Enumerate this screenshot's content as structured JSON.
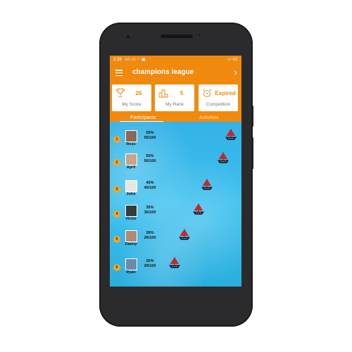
{
  "status": {
    "time": "3:38",
    "signal": "ııl ııl ◔ ▣",
    "right": "▭ 42"
  },
  "appbar": {
    "title": "champions league"
  },
  "cards": [
    {
      "value": "26",
      "label": "My Score",
      "icon": "trophy-icon"
    },
    {
      "value": "5",
      "label": "My Rank",
      "icon": "podium-icon"
    },
    {
      "value": "Expired",
      "label": "Competition",
      "icon": "alarm-clock-icon"
    }
  ],
  "tabs": {
    "participants": "Participants",
    "activities": "Activities"
  },
  "participants": [
    {
      "rank": "1",
      "name": "Ross",
      "percent": "55%",
      "score": "55/100",
      "progress": 0.55
    },
    {
      "rank": "2",
      "name": "April",
      "percent": "50%",
      "score": "50/100",
      "progress": 0.5
    },
    {
      "rank": "3",
      "name": "John",
      "percent": "40%",
      "score": "40/100",
      "progress": 0.4
    },
    {
      "rank": "4",
      "name": "Victor",
      "percent": "35%",
      "score": "35/100",
      "progress": 0.35
    },
    {
      "rank": "5",
      "name": "Danny",
      "percent": "26%",
      "score": "26/100",
      "progress": 0.26
    },
    {
      "rank": "6",
      "name": "Ryan",
      "percent": "20%",
      "score": "20/100",
      "progress": 0.2
    }
  ],
  "colors": {
    "accent": "#f08a0f",
    "water": "#34b6e8",
    "rank_badge": "#f5a623",
    "sail": "#d81f26",
    "hull": "#1d1d2b"
  }
}
